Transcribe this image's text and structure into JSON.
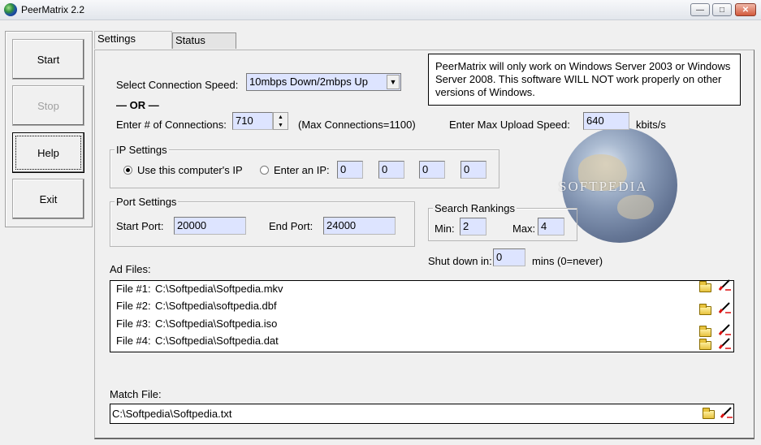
{
  "window": {
    "title": "PeerMatrix 2.2"
  },
  "buttons": {
    "start": "Start",
    "stop": "Stop",
    "help": "Help",
    "exit": "Exit"
  },
  "tabs": [
    {
      "label": "Settings",
      "active": true
    },
    {
      "label": "Status",
      "active": false
    }
  ],
  "notice": "PeerMatrix will only work on Windows Server 2003 or Windows Server 2008. This software WILL NOT work properly on other versions of Windows.",
  "connection": {
    "speed_label": "Select Connection Speed:",
    "speed_value": "10mbps Down/2mbps Up",
    "or_label": "— OR —",
    "count_label": "Enter # of Connections:",
    "count_value": "710",
    "max_note": "(Max Connections=1100)",
    "upload_label": "Enter Max Upload Speed:",
    "upload_value": "640",
    "upload_unit": "kbits/s"
  },
  "ip_settings": {
    "title": "IP Settings",
    "use_computer_ip": "Use this computer's IP",
    "enter_ip": "Enter an IP:",
    "selected": "use_computer_ip",
    "octets": [
      "0",
      "0",
      "0",
      "0"
    ]
  },
  "port_settings": {
    "title": "Port Settings",
    "start_label": "Start Port:",
    "start_value": "20000",
    "end_label": "End Port:",
    "end_value": "24000"
  },
  "search_rankings": {
    "title": "Search Rankings",
    "min_label": "Min:",
    "min_value": "2",
    "max_label": "Max:",
    "max_value": "4"
  },
  "shutdown": {
    "label": "Shut down in:",
    "value": "0",
    "suffix": "mins (0=never)"
  },
  "ad_files": {
    "label": "Ad Files:",
    "items": [
      {
        "label": "File #1:",
        "path": "C:\\Softpedia\\Softpedia.mkv"
      },
      {
        "label": "File #2:",
        "path": "C:\\Softpedia\\softpedia.dbf"
      },
      {
        "label": "File #3:",
        "path": "C:\\Softpedia\\Softpedia.iso"
      },
      {
        "label": "File #4:",
        "path": "C:\\Softpedia\\Softpedia.dat"
      }
    ]
  },
  "match_file": {
    "label": "Match File:",
    "path": "C:\\Softpedia\\Softpedia.txt"
  },
  "watermark": "SOFTPEDIA",
  "icons": {
    "app": "globe-icon",
    "folder": "folder-open-icon",
    "clear": "eraser-icon",
    "minimize": "minimize-icon",
    "maximize": "maximize-icon",
    "close": "close-icon"
  }
}
